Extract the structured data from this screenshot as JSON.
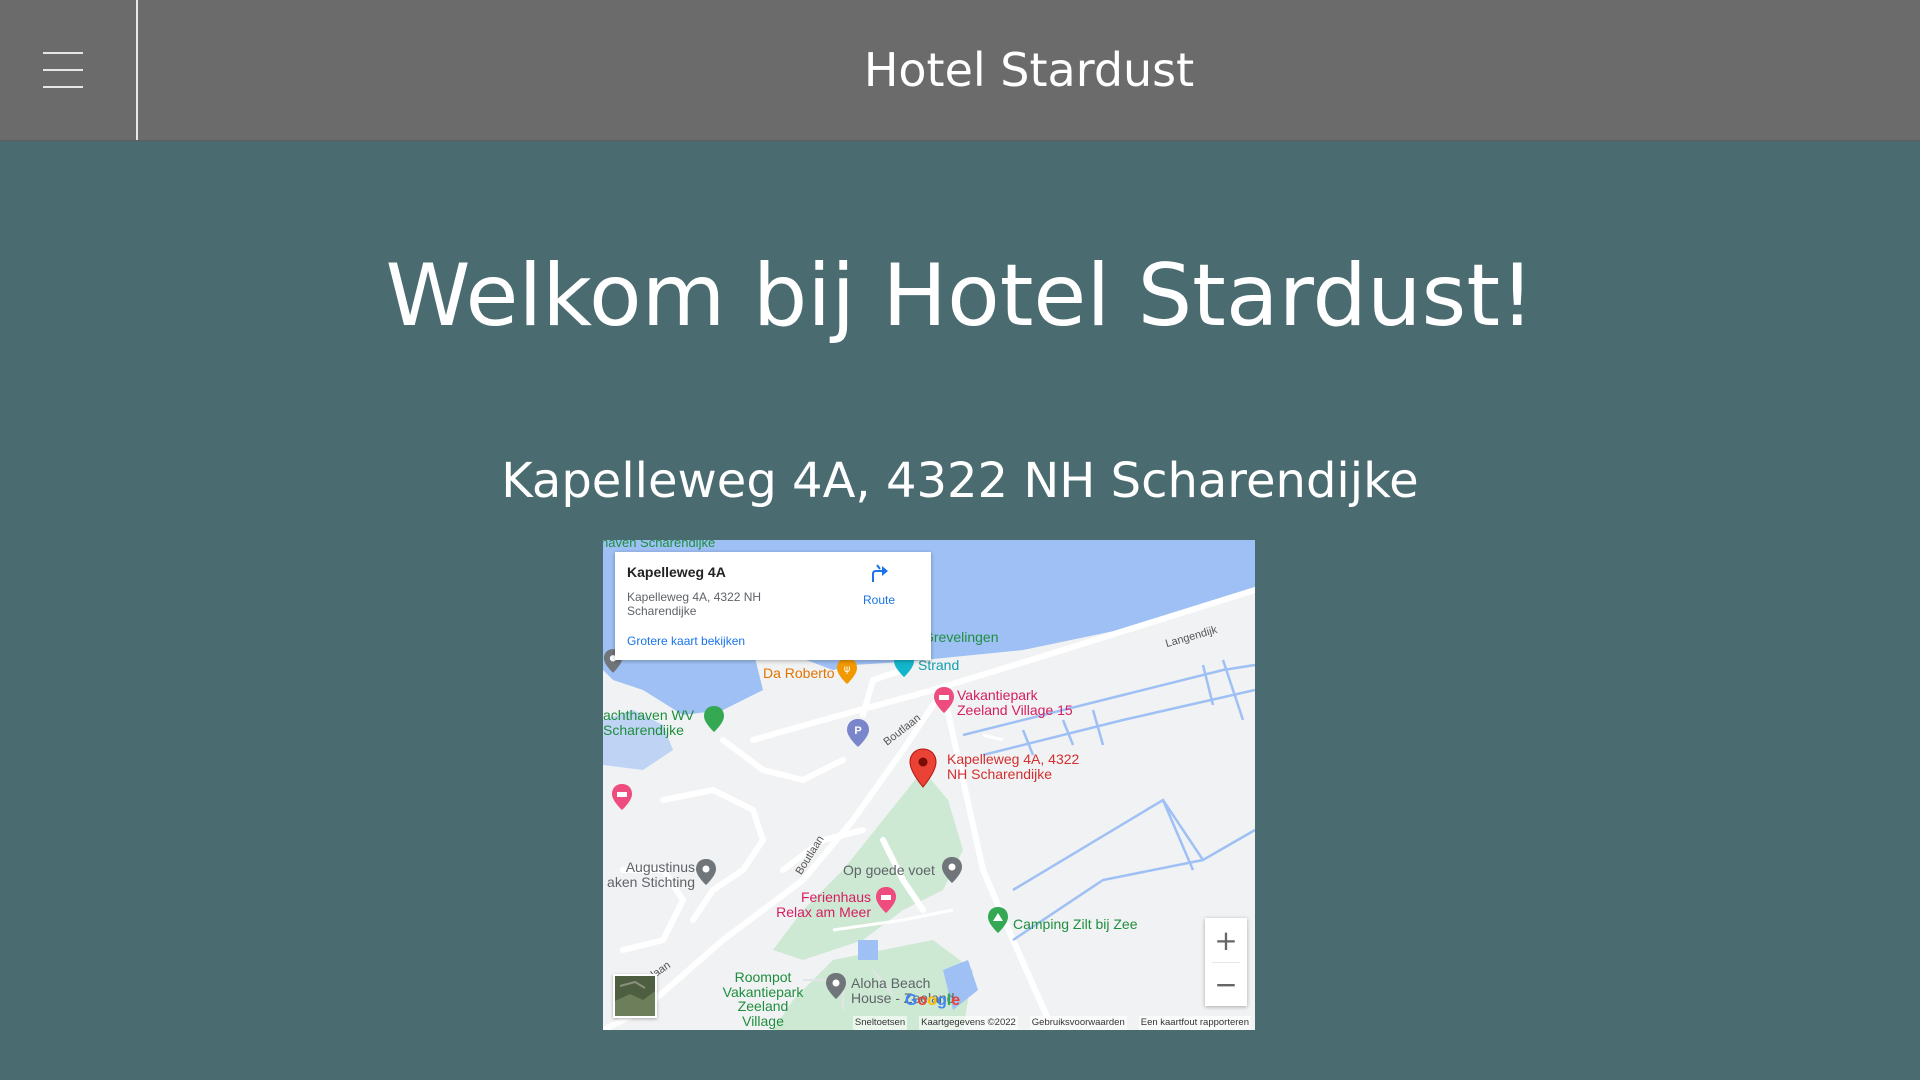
{
  "header": {
    "menu_icon": "hamburger-menu-icon",
    "title": "Hotel Stardust"
  },
  "main": {
    "welcome": "Welkom bij Hotel Stardust!",
    "address": "Kapelleweg 4A, 4322 NH Scharendijke"
  },
  "map": {
    "infocard": {
      "name": "Kapelleweg 4A",
      "address": "Kapelleweg 4A, 4322 NH Scharendijke",
      "route_label": "Route",
      "larger_map": "Grotere kaart bekijken"
    },
    "labels": {
      "harbor_top": "haven Scharendijke",
      "grevelingen": "Grevelingen",
      "strand": "Strand",
      "da_roberto": "Da Roberto",
      "vakantiepark": "Vakantiepark\nZeeland Village 15",
      "jachthaven": "achthaven WV\nScharendijke",
      "marker": "Kapelleweg 4A, 4322\nNH Scharendijke",
      "augustinus": "Augustinus\naken Stichting",
      "op_goede_voet": "Op goede voet",
      "ferienhaus": "Ferienhaus\nRelax am Meer",
      "camping": "Camping Zilt bij Zee",
      "roompot": "Roompot\nVakantiepark\nZeeland\nVillage",
      "aloha": "Aloha Beach\nHouse - Zeeland",
      "langendijk": "Langendijk",
      "boutlaan1": "Boutlaan",
      "boutlaan2": "Boutlaan",
      "laan": "laan",
      "parking": "P"
    },
    "controls": {
      "zoom_in": "+",
      "zoom_out": "−"
    },
    "google": "Google",
    "footer": [
      "Sneltoetsen",
      "Kaartgegevens ©2022",
      "Gebruiksvoorwaarden",
      "Een kaartfout rapporteren"
    ],
    "colors": {
      "water": "#9ec0f5",
      "park": "#cde9d3",
      "road": "#ffffff",
      "marker": "#ea4335"
    }
  }
}
